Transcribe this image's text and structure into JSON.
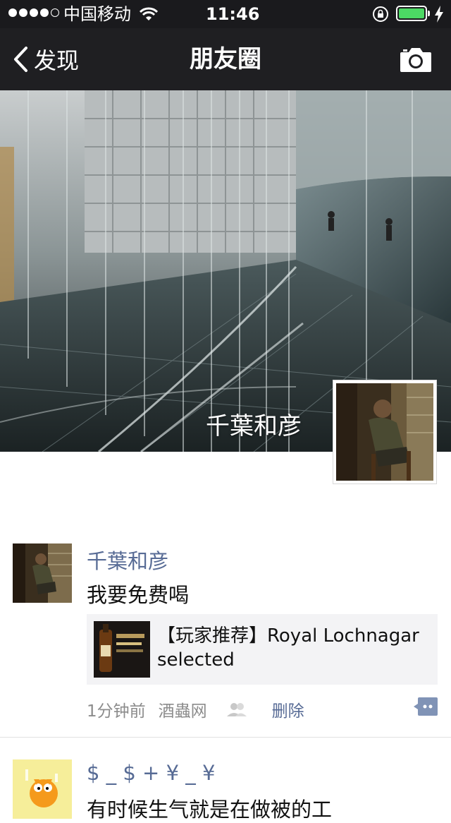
{
  "status_bar": {
    "carrier": "中国移动",
    "time": "11:46"
  },
  "nav": {
    "back_label": "发现",
    "title": "朋友圈"
  },
  "cover": {
    "user_name": "千葉和彦"
  },
  "posts": [
    {
      "author": "千葉和彦",
      "text": "我要免费喝",
      "link_title": "【玩家推荐】Royal Lochnagar selected",
      "time": "1分钟前",
      "source": "酒蟲网",
      "delete_label": "删除"
    },
    {
      "author": "$ _ $   +   ¥ _ ¥",
      "text": "有时候生气就是在做被的工"
    }
  ],
  "colors": {
    "nav_bg": "#1f1f22",
    "name_link": "#576b95",
    "battery": "#4cd964"
  }
}
